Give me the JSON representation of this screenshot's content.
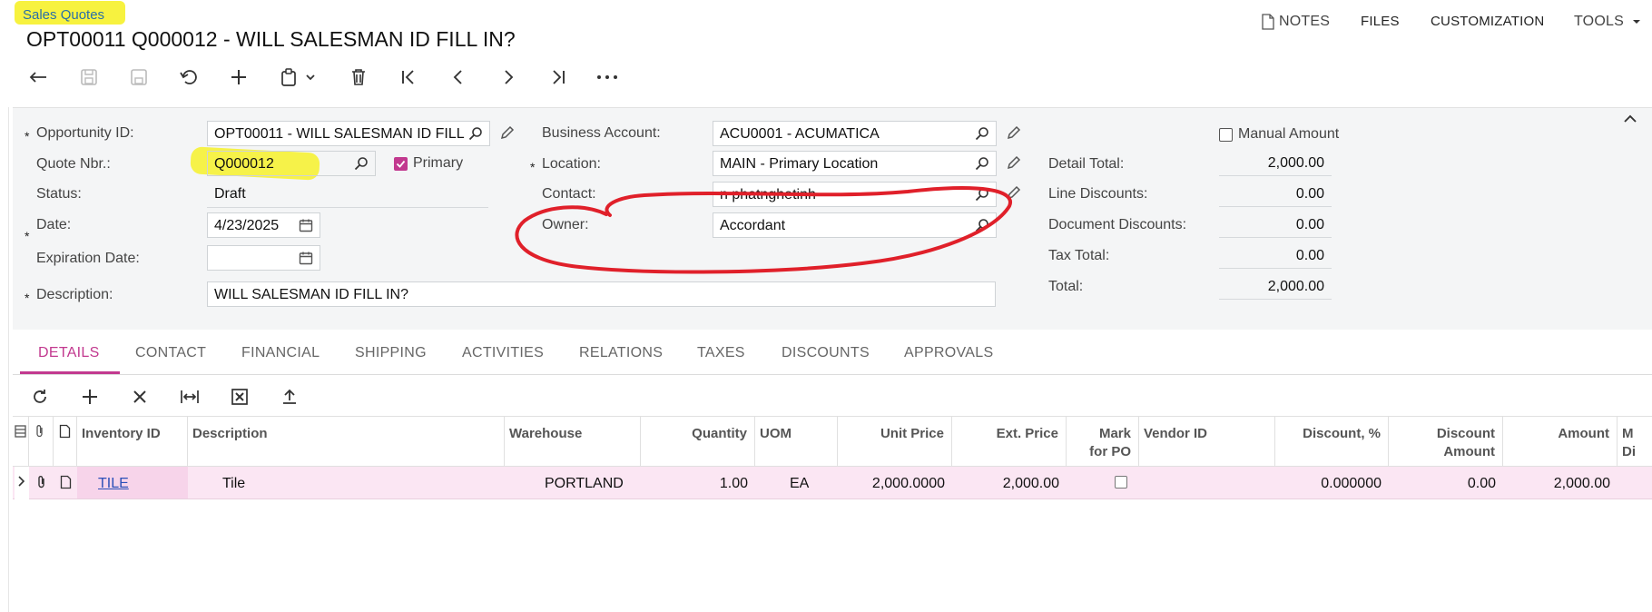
{
  "header": {
    "breadcrumb": "Sales Quotes",
    "title": "OPT00011 Q000012 - WILL SALESMAN ID FILL IN?",
    "menu": {
      "notes": "NOTES",
      "files": "FILES",
      "customization": "CUSTOMIZATION",
      "tools": "TOOLS"
    }
  },
  "form": {
    "opportunity_id_label": "Opportunity ID:",
    "opportunity_id_value": "OPT00011 - WILL SALESMAN ID FILL",
    "quote_nbr_label": "Quote Nbr.:",
    "quote_nbr_value": "Q000012",
    "primary_label": "Primary",
    "status_label": "Status:",
    "status_value": "Draft",
    "date_label": "Date:",
    "date_value": "4/23/2025",
    "expiration_label": "Expiration Date:",
    "expiration_value": "",
    "description_label": "Description:",
    "description_value": "WILL SALESMAN ID FILL IN?",
    "business_account_label": "Business Account:",
    "business_account_value": "ACU0001 - ACUMATICA",
    "location_label": "Location:",
    "location_value": "MAIN - Primary Location",
    "contact_label": "Contact:",
    "contact_value": "n phatnghetinh",
    "owner_label": "Owner:",
    "owner_value": "Accordant",
    "manual_amount_label": "Manual Amount",
    "detail_total_label": "Detail Total:",
    "detail_total_value": "2,000.00",
    "line_discounts_label": "Line Discounts:",
    "line_discounts_value": "0.00",
    "document_discounts_label": "Document Discounts:",
    "document_discounts_value": "0.00",
    "tax_total_label": "Tax Total:",
    "tax_total_value": "0.00",
    "total_label": "Total:",
    "total_value": "2,000.00"
  },
  "tabs": [
    "DETAILS",
    "CONTACT",
    "FINANCIAL",
    "SHIPPING",
    "ACTIVITIES",
    "RELATIONS",
    "TAXES",
    "DISCOUNTS",
    "APPROVALS"
  ],
  "grid": {
    "headers": {
      "inventory_id": "Inventory ID",
      "description": "Description",
      "warehouse": "Warehouse",
      "quantity": "Quantity",
      "uom": "UOM",
      "unit_price": "Unit Price",
      "ext_price": "Ext. Price",
      "mark_po_1": "Mark",
      "mark_po_2": "for PO",
      "vendor_id": "Vendor ID",
      "discount_pct": "Discount, %",
      "discount_amount_1": "Discount",
      "discount_amount_2": "Amount",
      "amount": "Amount",
      "trunc_1": "M",
      "trunc_2": "Di"
    },
    "rows": [
      {
        "inventory_id": "TILE",
        "description": "Tile",
        "warehouse": "PORTLAND",
        "quantity": "1.00",
        "uom": "EA",
        "unit_price": "2,000.0000",
        "ext_price": "2,000.00",
        "vendor_id": "",
        "discount_pct": "0.000000",
        "discount_amount": "0.00",
        "amount": "2,000.00"
      }
    ]
  },
  "colors": {
    "accent": "#c2398f",
    "highlight": "#f6f12a",
    "annotation": "#e0202a",
    "link": "#2a4fb8"
  }
}
